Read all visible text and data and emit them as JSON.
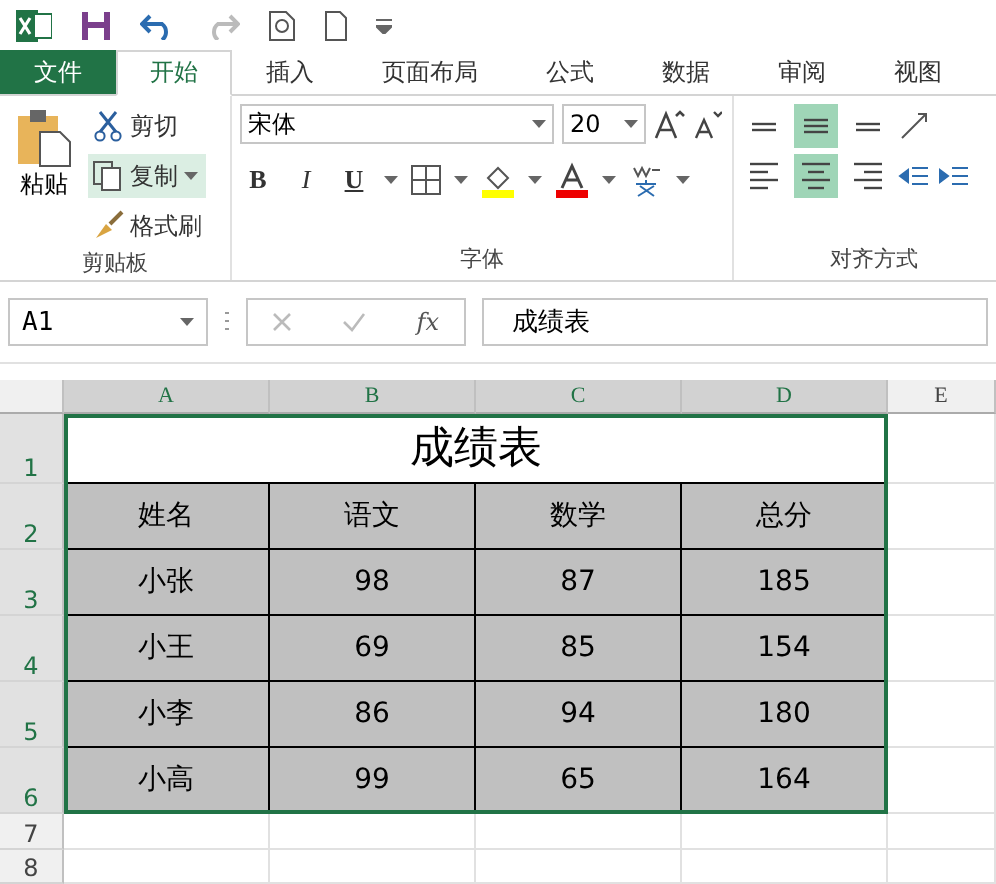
{
  "tabs": [
    {
      "label": "文件",
      "kind": "file",
      "selected": false
    },
    {
      "label": "开始",
      "kind": "tab",
      "selected": true
    },
    {
      "label": "插入",
      "kind": "tab",
      "selected": false
    },
    {
      "label": "页面布局",
      "kind": "tab",
      "selected": false
    },
    {
      "label": "公式",
      "kind": "tab",
      "selected": false
    },
    {
      "label": "数据",
      "kind": "tab",
      "selected": false
    },
    {
      "label": "审阅",
      "kind": "tab",
      "selected": false
    },
    {
      "label": "视图",
      "kind": "tab",
      "selected": false
    }
  ],
  "clipboard": {
    "label": "剪贴板",
    "paste": "粘贴",
    "cut": "剪切",
    "copy": "复制",
    "format_painter": "格式刷"
  },
  "font": {
    "label": "字体",
    "font_name": "宋体",
    "font_size": "20",
    "bold": "B",
    "italic": "I",
    "underline": "U"
  },
  "alignment": {
    "label": "对齐方式",
    "top_row": [
      {
        "kind": "top",
        "selected": false
      },
      {
        "kind": "middle",
        "selected": true
      },
      {
        "kind": "bottom",
        "selected": false
      }
    ],
    "bottom_row": [
      {
        "kind": "left",
        "selected": false
      },
      {
        "kind": "center",
        "selected": true
      },
      {
        "kind": "right",
        "selected": false
      }
    ]
  },
  "formula_bar": {
    "name_box": "A1",
    "function_label": "fx",
    "formula": "成绩表"
  },
  "sheet": {
    "columns": [
      {
        "label": "A",
        "selected": true
      },
      {
        "label": "B",
        "selected": true
      },
      {
        "label": "C",
        "selected": true
      },
      {
        "label": "D",
        "selected": true
      },
      {
        "label": "E",
        "selected": false
      }
    ],
    "rows": [
      {
        "label": "1",
        "selected": true
      },
      {
        "label": "2",
        "selected": true
      },
      {
        "label": "3",
        "selected": true
      },
      {
        "label": "4",
        "selected": true
      },
      {
        "label": "5",
        "selected": true
      },
      {
        "label": "6",
        "selected": true
      },
      {
        "label": "7",
        "selected": false
      },
      {
        "label": "8",
        "selected": false
      }
    ],
    "table_selected": true,
    "title": "成绩表",
    "header": [
      "姓名",
      "语文",
      "数学",
      "总分"
    ],
    "data": [
      [
        "小张",
        "98",
        "87",
        "185"
      ],
      [
        "小王",
        "69",
        "85",
        "154"
      ],
      [
        "小李",
        "86",
        "94",
        "180"
      ],
      [
        "小高",
        "99",
        "65",
        "164"
      ]
    ]
  }
}
